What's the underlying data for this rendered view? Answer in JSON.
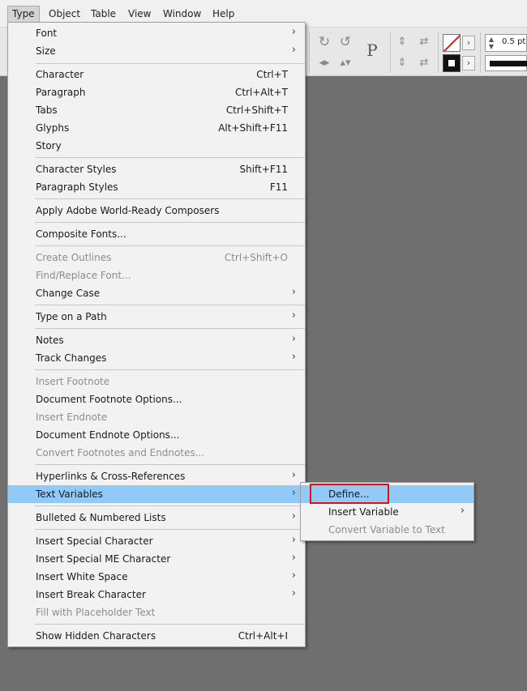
{
  "menubar": {
    "items": [
      "Type",
      "Object",
      "Table",
      "View",
      "Window",
      "Help"
    ],
    "active": "Type"
  },
  "toolbar": {
    "stroke_weight": "0.5 pt",
    "paragraph_icon": "P",
    "icons": [
      "rotate-cw-icon",
      "rotate-ccw-icon",
      "flip-horizontal-icon",
      "flip-vertical-icon",
      "paragraph-icon",
      "distribute-icon",
      "stroke-swatch",
      "fill-swatch",
      "chevron-right-icon"
    ]
  },
  "type_menu": {
    "items": [
      {
        "label": "Font",
        "shortcut": "",
        "submenu": true,
        "disabled": false
      },
      {
        "label": "Size",
        "shortcut": "",
        "submenu": true,
        "disabled": false
      },
      {
        "label": "Character",
        "shortcut": "Ctrl+T",
        "submenu": false,
        "disabled": false
      },
      {
        "label": "Paragraph",
        "shortcut": "Ctrl+Alt+T",
        "submenu": false,
        "disabled": false
      },
      {
        "label": "Tabs",
        "shortcut": "Ctrl+Shift+T",
        "submenu": false,
        "disabled": false
      },
      {
        "label": "Glyphs",
        "shortcut": "Alt+Shift+F11",
        "submenu": false,
        "disabled": false
      },
      {
        "label": "Story",
        "shortcut": "",
        "submenu": false,
        "disabled": false
      },
      {
        "label": "Character Styles",
        "shortcut": "Shift+F11",
        "submenu": false,
        "disabled": false
      },
      {
        "label": "Paragraph Styles",
        "shortcut": "F11",
        "submenu": false,
        "disabled": false
      },
      {
        "label": "Apply Adobe World-Ready Composers",
        "shortcut": "",
        "submenu": false,
        "disabled": false
      },
      {
        "label": "Composite Fonts...",
        "shortcut": "",
        "submenu": false,
        "disabled": false
      },
      {
        "label": "Create Outlines",
        "shortcut": "Ctrl+Shift+O",
        "submenu": false,
        "disabled": true
      },
      {
        "label": "Find/Replace Font...",
        "shortcut": "",
        "submenu": false,
        "disabled": true
      },
      {
        "label": "Change Case",
        "shortcut": "",
        "submenu": true,
        "disabled": false
      },
      {
        "label": "Type on a Path",
        "shortcut": "",
        "submenu": true,
        "disabled": false
      },
      {
        "label": "Notes",
        "shortcut": "",
        "submenu": true,
        "disabled": false
      },
      {
        "label": "Track Changes",
        "shortcut": "",
        "submenu": true,
        "disabled": false
      },
      {
        "label": "Insert Footnote",
        "shortcut": "",
        "submenu": false,
        "disabled": true
      },
      {
        "label": "Document Footnote Options...",
        "shortcut": "",
        "submenu": false,
        "disabled": false
      },
      {
        "label": "Insert Endnote",
        "shortcut": "",
        "submenu": false,
        "disabled": true
      },
      {
        "label": "Document Endnote Options...",
        "shortcut": "",
        "submenu": false,
        "disabled": false
      },
      {
        "label": "Convert Footnotes and Endnotes...",
        "shortcut": "",
        "submenu": false,
        "disabled": true
      },
      {
        "label": "Hyperlinks & Cross-References",
        "shortcut": "",
        "submenu": true,
        "disabled": false
      },
      {
        "label": "Text Variables",
        "shortcut": "",
        "submenu": true,
        "disabled": false,
        "highlighted": true
      },
      {
        "label": "Bulleted & Numbered Lists",
        "shortcut": "",
        "submenu": true,
        "disabled": false
      },
      {
        "label": "Insert Special Character",
        "shortcut": "",
        "submenu": true,
        "disabled": false
      },
      {
        "label": "Insert Special ME Character",
        "shortcut": "",
        "submenu": true,
        "disabled": false
      },
      {
        "label": "Insert White Space",
        "shortcut": "",
        "submenu": true,
        "disabled": false
      },
      {
        "label": "Insert Break Character",
        "shortcut": "",
        "submenu": true,
        "disabled": false
      },
      {
        "label": "Fill with Placeholder Text",
        "shortcut": "",
        "submenu": false,
        "disabled": true
      },
      {
        "label": "Show Hidden Characters",
        "shortcut": "Ctrl+Alt+I",
        "submenu": false,
        "disabled": false
      }
    ]
  },
  "text_variables_submenu": {
    "items": [
      {
        "label": "Define...",
        "submenu": false,
        "disabled": false,
        "highlighted": true
      },
      {
        "label": "Insert Variable",
        "submenu": true,
        "disabled": false
      },
      {
        "label": "Convert Variable to Text",
        "submenu": false,
        "disabled": true
      }
    ]
  },
  "colors": {
    "highlight": "#91c9f7",
    "annotation_box": "#e01010",
    "pasteboard": "#6f6f6f"
  }
}
